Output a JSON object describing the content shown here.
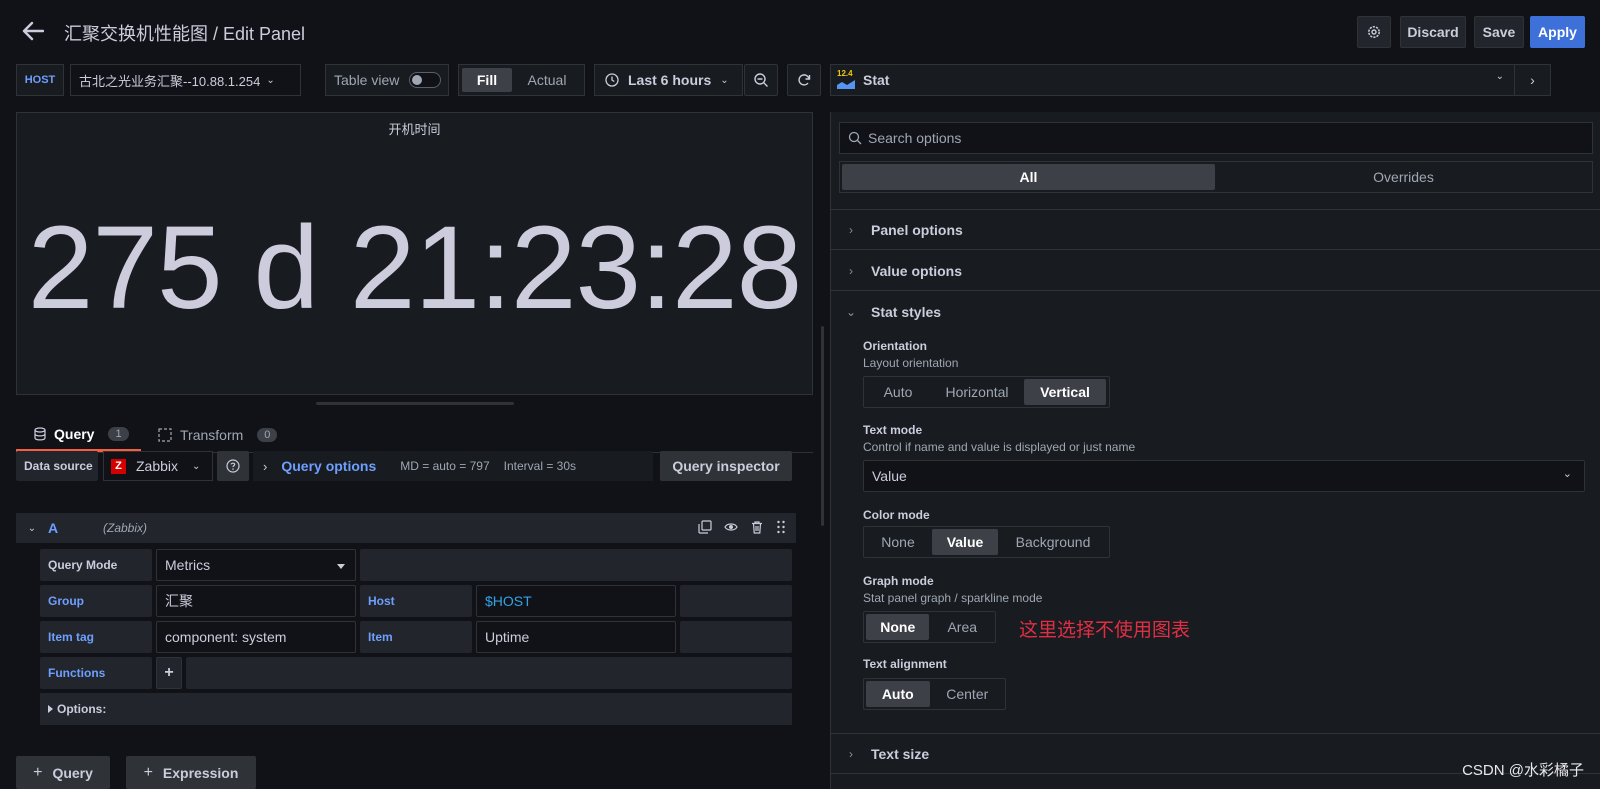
{
  "header": {
    "title": "汇聚交换机性能图 / Edit Panel",
    "discard_label": "Discard",
    "save_label": "Save",
    "apply_label": "Apply"
  },
  "toolbar": {
    "var_name": "HOST",
    "var_value": "古北之光业务汇聚--10.88.1.254",
    "table_view_label": "Table view",
    "table_view_on": false,
    "fill_label": "Fill",
    "actual_label": "Actual",
    "time_range": "Last 6 hours",
    "viz_badge": "12.4",
    "viz_name": "Stat"
  },
  "panel": {
    "title": "开机时间",
    "value": "275 d 21:23:28"
  },
  "query_tabs": [
    {
      "label": "Query",
      "count": "1"
    },
    {
      "label": "Transform",
      "count": "0"
    }
  ],
  "datasource": {
    "label": "Data source",
    "name": "Zabbix",
    "icon_letter": "Z",
    "query_options_label": "Query options",
    "md": "MD = auto = 797",
    "interval": "Interval = 30s",
    "inspector_label": "Query inspector"
  },
  "query_a": {
    "ref": "A",
    "ds": "(Zabbix)",
    "query_mode_label": "Query Mode",
    "query_mode_value": "Metrics",
    "group_label": "Group",
    "group_value": "汇聚",
    "host_label": "Host",
    "host_value": "$HOST",
    "item_tag_label": "Item tag",
    "item_tag_value": "component: system",
    "item_label": "Item",
    "item_value": "Uptime",
    "functions_label": "Functions",
    "options_label": "Options:"
  },
  "bottom_buttons": {
    "query_label": "Query",
    "expression_label": "Expression"
  },
  "options_pane": {
    "search_placeholder": "Search options",
    "tab_all": "All",
    "tab_overrides": "Overrides",
    "panel_options": "Panel options",
    "value_options": "Value options",
    "stat_styles": "Stat styles",
    "text_size": "Text size",
    "orientation": {
      "title": "Orientation",
      "desc": "Layout orientation",
      "options": [
        "Auto",
        "Horizontal",
        "Vertical"
      ],
      "selected": "Vertical"
    },
    "text_mode": {
      "title": "Text mode",
      "desc": "Control if name and value is displayed or just name",
      "value": "Value"
    },
    "color_mode": {
      "title": "Color mode",
      "options": [
        "None",
        "Value",
        "Background"
      ],
      "selected": "Value"
    },
    "graph_mode": {
      "title": "Graph mode",
      "desc": "Stat panel graph / sparkline mode",
      "options": [
        "None",
        "Area"
      ],
      "selected": "None"
    },
    "text_alignment": {
      "title": "Text alignment",
      "options": [
        "Auto",
        "Center"
      ],
      "selected": "Auto"
    },
    "annotation": "这里选择不使用图表"
  },
  "watermark": "CSDN @水彩橘子",
  "colors": {
    "accent": "#3d71d9",
    "link": "#6e9fff",
    "annotation": "#e02f44",
    "tab_underline": "#f55f3e",
    "host_value": "#33a2e5"
  }
}
